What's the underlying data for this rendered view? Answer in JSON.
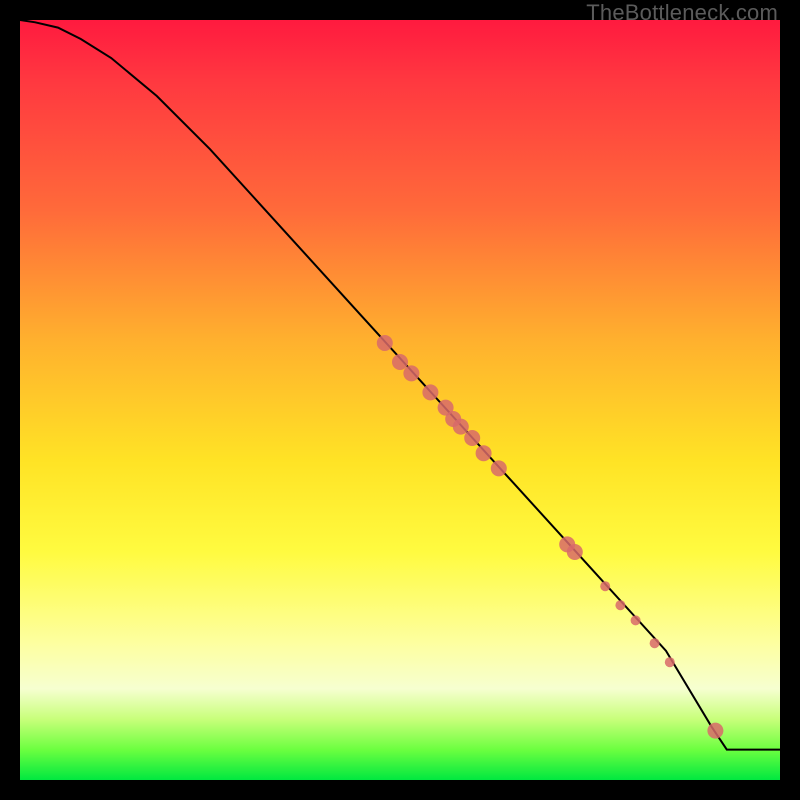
{
  "watermark": "TheBottleneck.com",
  "chart_data": {
    "type": "line",
    "title": "",
    "xlabel": "",
    "ylabel": "",
    "xlim": [
      0,
      100
    ],
    "ylim": [
      0,
      100
    ],
    "curve": {
      "x": [
        0,
        2,
        5,
        8,
        12,
        18,
        25,
        35,
        45,
        55,
        65,
        75,
        85,
        91,
        93,
        100
      ],
      "y": [
        100,
        99.7,
        99,
        97.5,
        95,
        90,
        83,
        72,
        61,
        50,
        39,
        28,
        17,
        7,
        4,
        4
      ]
    },
    "series": [
      {
        "name": "points-large",
        "marker_radius": 8,
        "points": [
          {
            "x": 48,
            "y": 57.5
          },
          {
            "x": 50,
            "y": 55
          },
          {
            "x": 51.5,
            "y": 53.5
          },
          {
            "x": 54,
            "y": 51
          },
          {
            "x": 56,
            "y": 49
          },
          {
            "x": 57,
            "y": 47.5
          },
          {
            "x": 58,
            "y": 46.5
          },
          {
            "x": 59.5,
            "y": 45
          },
          {
            "x": 61,
            "y": 43
          },
          {
            "x": 63,
            "y": 41
          },
          {
            "x": 72,
            "y": 31
          },
          {
            "x": 73,
            "y": 30
          },
          {
            "x": 91.5,
            "y": 6.5
          }
        ]
      },
      {
        "name": "points-small",
        "marker_radius": 5,
        "points": [
          {
            "x": 77,
            "y": 25.5
          },
          {
            "x": 79,
            "y": 23
          },
          {
            "x": 81,
            "y": 21
          },
          {
            "x": 83.5,
            "y": 18
          },
          {
            "x": 85.5,
            "y": 15.5
          }
        ]
      }
    ]
  }
}
